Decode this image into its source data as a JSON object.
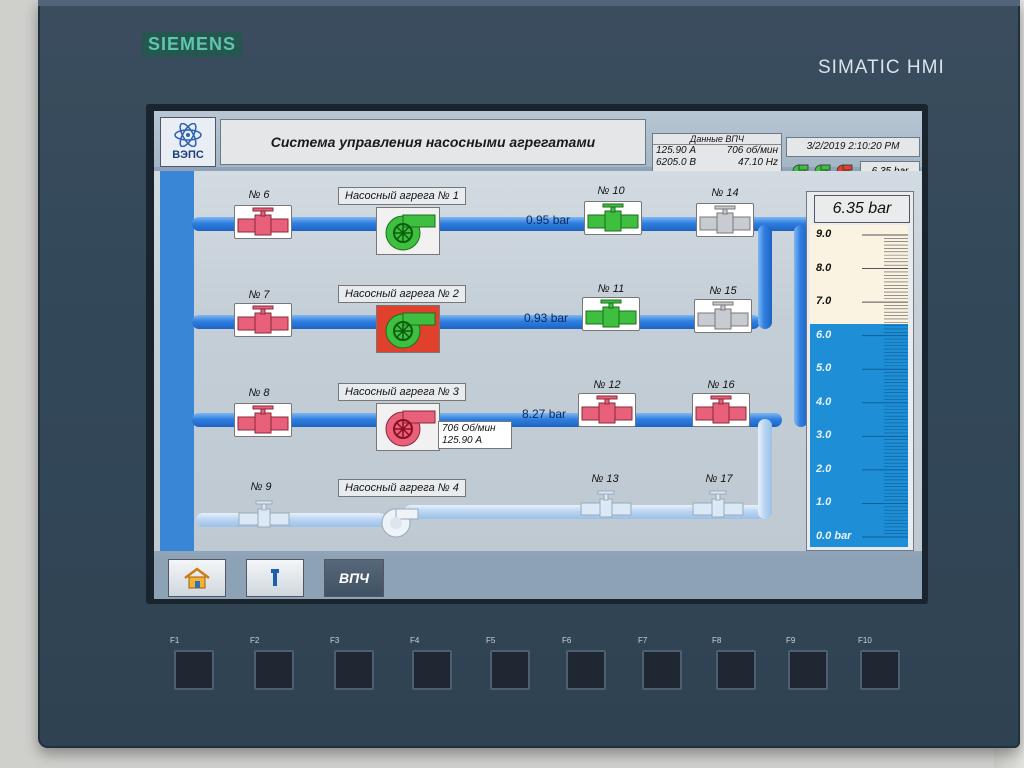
{
  "device": {
    "brand": "SIEMENS",
    "model": "SIMATIC HMI"
  },
  "header": {
    "logo_text": "ВЭПС",
    "title": "Система управления насосными агрегатами",
    "vpch": {
      "title": "Данные ВПЧ",
      "current": "125.90",
      "current_unit": "A",
      "rpm": "706",
      "rpm_unit": "об/мин",
      "voltage": "6205.0",
      "voltage_unit": "B",
      "frequency": "47.10",
      "frequency_unit": "Hz"
    },
    "datetime": "3/2/2019 2:10:20 PM",
    "pressure_mini": "6.35  bar",
    "pump_status_colors": [
      "#3fbf3f",
      "#3fbf3f",
      "#e0402c"
    ]
  },
  "valves": {
    "v6": "№ 6",
    "v7": "№ 7",
    "v8": "№ 8",
    "v9": "№ 9",
    "v10": "№ 10",
    "v11": "№ 11",
    "v12": "№ 12",
    "v13": "№ 13",
    "v14": "№ 14",
    "v15": "№ 15",
    "v16": "№ 16",
    "v17": "№ 17"
  },
  "pumps": {
    "p1": "Насосный агрега № 1",
    "p2": "Насосный агрега № 2",
    "p3": "Насосный агрега № 3",
    "p4": "Насосный агрега № 4"
  },
  "flows": {
    "line1": "0.95 bar",
    "line2": "0.93 bar",
    "line3": "8.27 bar"
  },
  "pump3_info": {
    "rpm": "706  Об/мин",
    "current": "125.90  А"
  },
  "gauge": {
    "value_text": "6.35  bar",
    "value": 6.35,
    "max": 9.0,
    "labels": [
      "9.0",
      "8.0",
      "7.0",
      "6.0",
      "5.0",
      "4.0",
      "3.0",
      "2.0",
      "1.0",
      "0.0 bar"
    ]
  },
  "nav": {
    "home": "home-icon",
    "settings": "wrench-icon",
    "vpch": "ВПЧ"
  },
  "fkeys": [
    "F1",
    "F2",
    "F3",
    "F4",
    "F5",
    "F6",
    "F7",
    "F8",
    "F9",
    "F10"
  ],
  "colors": {
    "valve_open": "#3fbf3f",
    "valve_closed": "#e8607a",
    "valve_idle": "#c8ccd2",
    "pipe_active": "#2f7fe0",
    "pipe_idle": "#b7d3f2",
    "pump_alarm": "#e0402c"
  }
}
